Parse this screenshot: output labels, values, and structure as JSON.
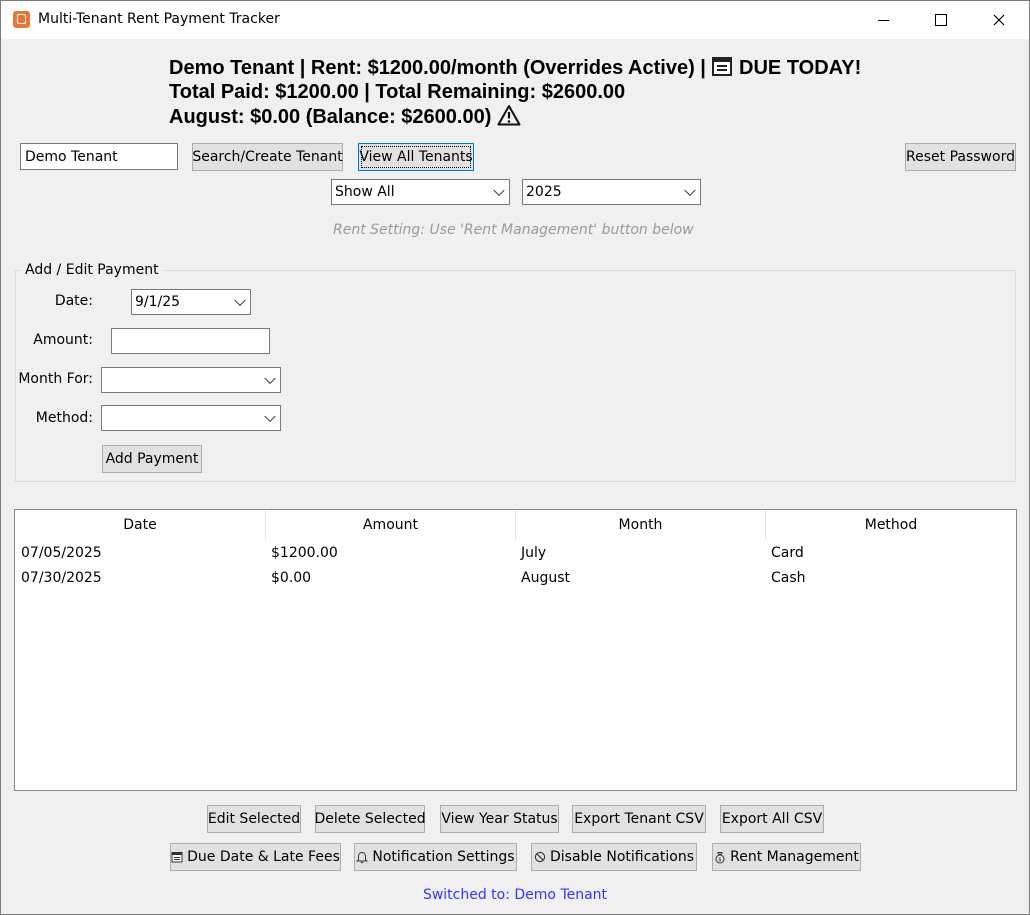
{
  "window": {
    "title": "Multi-Tenant Rent Payment Tracker"
  },
  "header": {
    "line1": "Demo Tenant | Rent: $1200.00/month (Overrides Active) |",
    "due_text": "DUE TODAY!",
    "line2": "Total Paid: $1200.00 | Total Remaining: $2600.00",
    "line3": "August: $0.00 (Balance: $2600.00)"
  },
  "tenant_bar": {
    "tenant_input_value": "Demo Tenant",
    "search_button": "Search/Create Tenant",
    "view_all_button": "View All Tenants",
    "reset_password_button": "Reset Password",
    "filter_selected": "Show All",
    "year_selected": "2025",
    "rent_setting_hint": "Rent Setting: Use 'Rent Management' button below"
  },
  "payment_form": {
    "group_title": "Add / Edit Payment",
    "date_label": "Date:",
    "date_value": "9/1/25",
    "amount_label": "Amount:",
    "amount_value": "",
    "month_label": "Month For:",
    "month_value": "",
    "method_label": "Method:",
    "method_value": "",
    "add_button": "Add Payment"
  },
  "table": {
    "columns": [
      "Date",
      "Amount",
      "Month",
      "Method"
    ],
    "rows": [
      [
        "07/05/2025",
        "$1200.00",
        "July",
        "Card"
      ],
      [
        "07/30/2025",
        "$0.00",
        "August",
        "Cash"
      ]
    ]
  },
  "actions": {
    "edit_selected": "Edit Selected",
    "delete_selected": "Delete Selected",
    "view_year_status": "View Year Status",
    "export_tenant_csv": "Export Tenant CSV",
    "export_all_csv": "Export All CSV",
    "due_date_late_fees": "Due Date & Late Fees",
    "notification_settings": "Notification Settings",
    "disable_notifications": "Disable Notifications",
    "rent_management": "Rent Management"
  },
  "status_text": "Switched to: Demo Tenant",
  "colors": {
    "window_bg": "#f0f0f0",
    "button_bg": "#e1e1e1",
    "status_text": "#3333ff",
    "hint_text": "#999999",
    "app_icon": "#e8763a"
  }
}
